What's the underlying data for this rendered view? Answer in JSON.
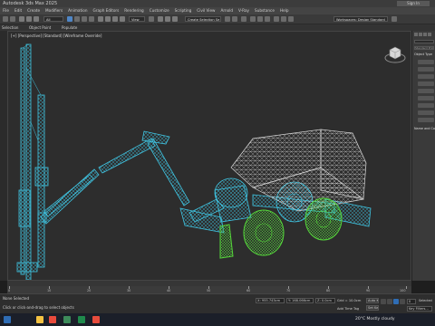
{
  "app": {
    "title": "Autodesk 3ds Max 2025",
    "signin": "Sign In"
  },
  "menu": [
    "File",
    "Edit",
    "Create",
    "Modifiers",
    "Animation",
    "Graph Editors",
    "Rendering",
    "Customize",
    "Scripting",
    "Civil View",
    "Arnold",
    "V-Ray",
    "Substance",
    "Help"
  ],
  "toolbar": {
    "filter": "All",
    "view": "View",
    "selection_set": "Create Selection Se",
    "workspace": "Workspaces: Design Standard"
  },
  "ribbon": {
    "selection": "Selection",
    "object_paint": "Object Paint",
    "populate": "Populate"
  },
  "viewport": {
    "label": "[+] [Perspective] [Standard] [Wireframe Override]"
  },
  "cmdpanel": {
    "object_type": "Object Type",
    "name_color": "Name and Color",
    "standard_primitives": "Standard Primitives"
  },
  "timeline": {
    "ticks": [
      "0",
      "10",
      "20",
      "30",
      "40",
      "50",
      "60",
      "70",
      "80",
      "90",
      "100"
    ]
  },
  "status": {
    "selected": "None Selected",
    "prompt": "Click or click-and-drag to select objects",
    "x": "X: 955.743cm",
    "y": "Y: 168.066cm",
    "z": "Z: 0.0cm",
    "grid": "Grid = 10.0cm",
    "auto_key": "Auto Key",
    "set_key": "Set Key",
    "add_time_tag": "Add Time Tag",
    "key_filters": "Key Filters...",
    "selected_dropdown": "Selected",
    "frame": "0"
  },
  "taskbar": {
    "weather": "20°C  Mostly cloudy"
  },
  "colors": {
    "wire_cyan": "#3fc3e0",
    "wire_green": "#55d63b",
    "wire_white": "#d6d6d6",
    "max_blue": "#2f6db5"
  }
}
